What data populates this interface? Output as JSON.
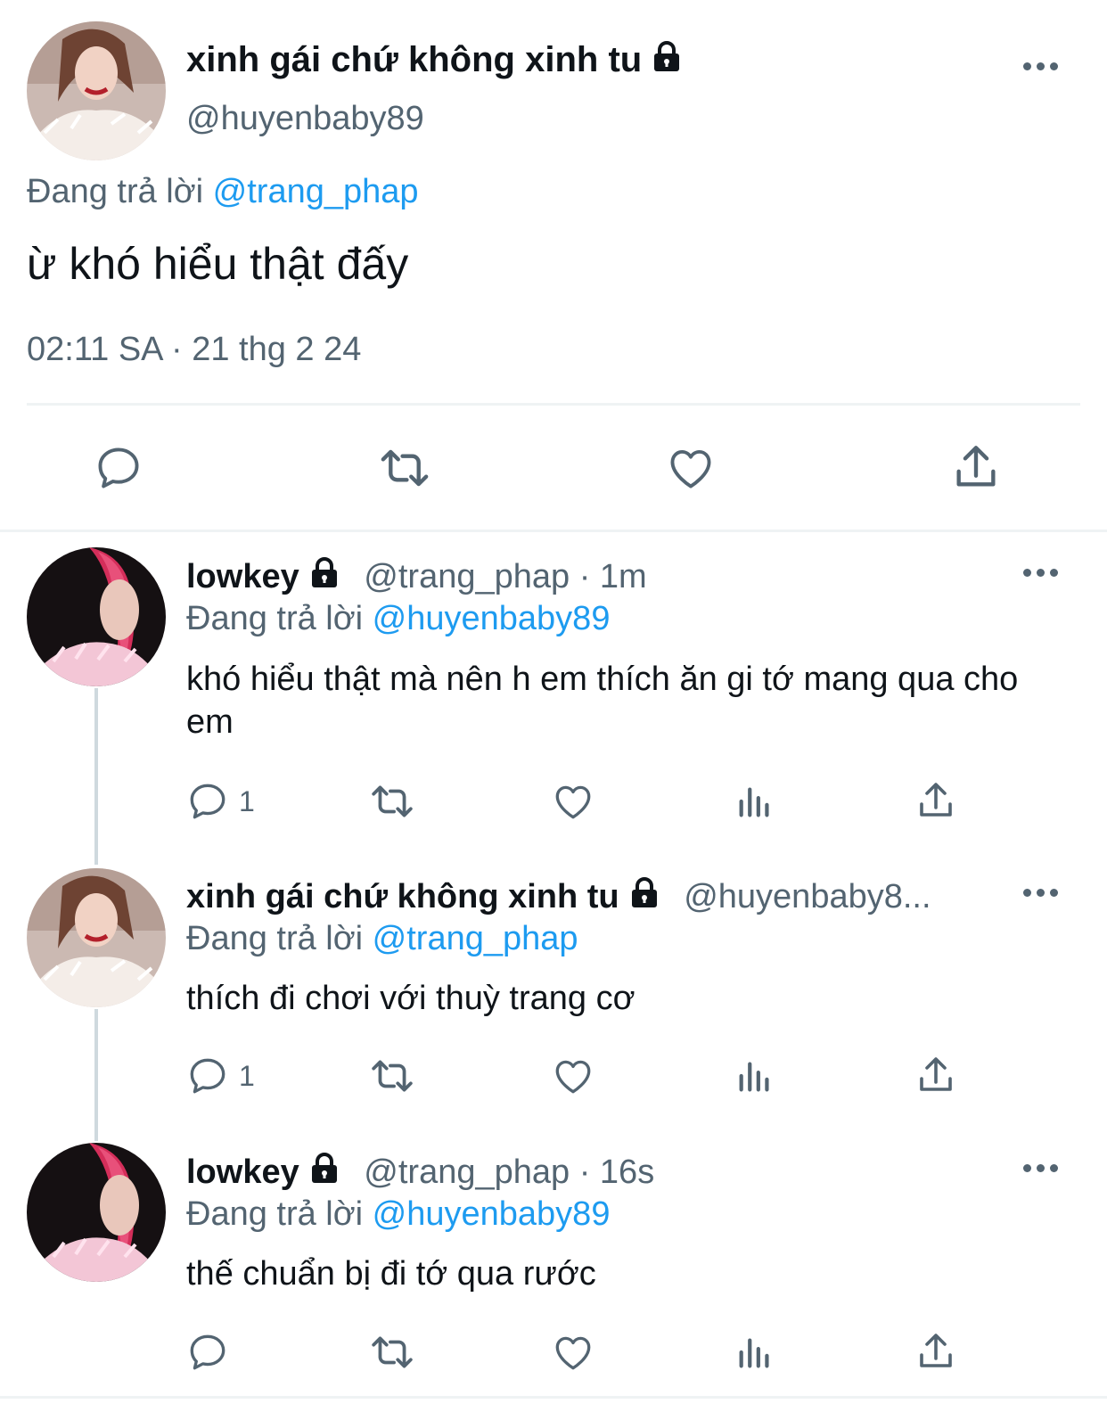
{
  "main_tweet": {
    "display_name": "xinh gái chứ không xinh tu",
    "handle": "@huyenbaby89",
    "reply_prefix": "Đang trả lời",
    "reply_to": "@trang_phap",
    "text": "ừ khó hiểu thật đấy",
    "timestamp": "02:11 SA · 21 thg 2 24"
  },
  "replies": [
    {
      "display_name": "lowkey",
      "handle_time": "@trang_phap · 1m",
      "reply_prefix": "Đang trả lời",
      "reply_to": "@huyenbaby89",
      "text": "khó hiểu thật mà nên h em thích ăn gi tớ mang qua cho em",
      "reply_count": "1"
    },
    {
      "display_name": "xinh gái chứ không xinh tu",
      "handle_time": "@huyenbaby8...",
      "reply_prefix": "Đang trả lời",
      "reply_to": "@trang_phap",
      "text": "thích đi chơi với thuỳ trang cơ",
      "reply_count": "1"
    },
    {
      "display_name": "lowkey",
      "handle_time": "@trang_phap · 16s",
      "reply_prefix": "Đang trả lời",
      "reply_to": "@huyenbaby89",
      "text": "thế chuẩn bị đi tớ qua rước",
      "reply_count": ""
    }
  ],
  "icons": {
    "lock": "lock-icon",
    "more": "more-icon",
    "reply": "reply-icon",
    "retweet": "retweet-icon",
    "like": "like-icon",
    "views": "views-icon",
    "share": "share-icon"
  },
  "colors": {
    "accent": "#1d9bf0",
    "text": "#0f1419",
    "secondary": "#536471",
    "divider": "#eff3f4"
  }
}
